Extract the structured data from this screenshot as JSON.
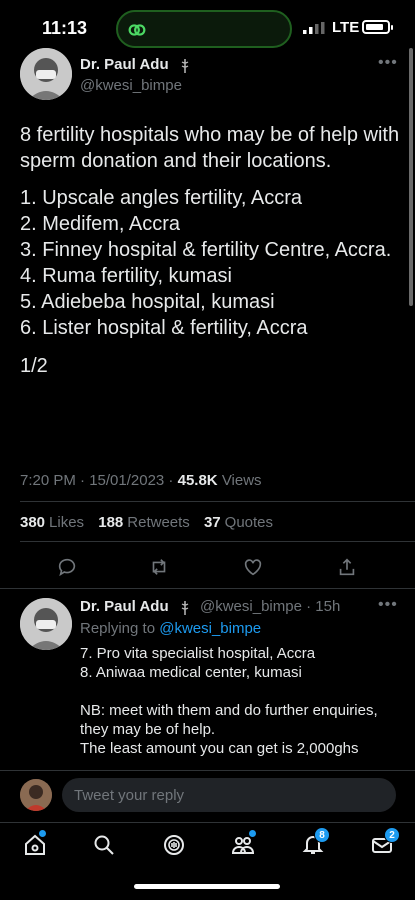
{
  "status_bar": {
    "time": "11:13",
    "network": "LTE"
  },
  "tweet": {
    "author_name": "Dr. Paul Adu",
    "author_handle": "@kwesi_bimpe",
    "intro": "8 fertility hospitals who may be of help with sperm donation and their locations.",
    "items": [
      "1. Upscale angles fertility, Accra",
      "2. Medifem, Accra",
      "3. Finney hospital & fertility Centre, Accra.",
      "4. Ruma fertility, kumasi",
      "5. Adiebeba hospital, kumasi",
      "6. Lister hospital & fertility, Accra"
    ],
    "footer": "1/2",
    "time": "7:20 PM · 15/01/2023 · ",
    "views_count": "45.8K",
    "views_label": "Views",
    "stats": {
      "likes_count": "380",
      "likes_label": "Likes",
      "retweets_count": "188",
      "retweets_label": "Retweets",
      "quotes_count": "37",
      "quotes_label": "Quotes"
    }
  },
  "reply": {
    "author_name": "Dr. Paul Adu",
    "handle_time": "@kwesi_bimpe · 15h",
    "replying_prefix": "Replying to",
    "replying_to": "@kwesi_bimpe",
    "lines": [
      "7. Pro vita specialist hospital, Accra",
      "8. Aniwaa medical center, kumasi"
    ],
    "note_lines": [
      "NB: meet with them and do further enquiries, they may be of help.",
      "The least amount you can get is 2,000ghs"
    ]
  },
  "composer": {
    "placeholder": "Tweet your reply"
  },
  "tabbar": {
    "notifications_count": "8",
    "messages_count": "2"
  },
  "colors": {
    "accent": "#1d9bf0",
    "background": "#000000",
    "secondary_text": "#71767b"
  }
}
